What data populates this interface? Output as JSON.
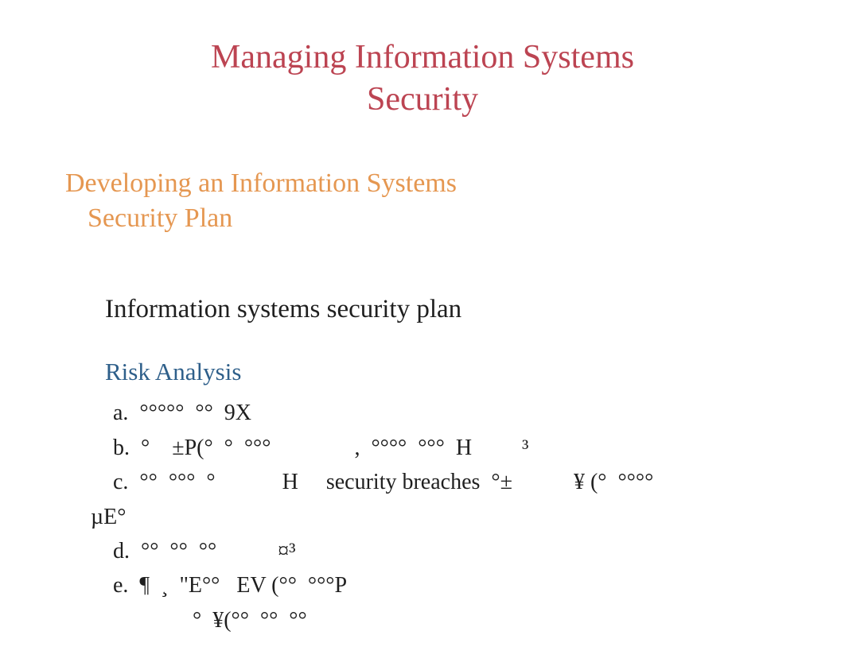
{
  "title_line1": "Managing Information Systems",
  "title_line2": "Security",
  "subtitle_line1": "Developing an Information Systems",
  "subtitle_line2": "Security Plan",
  "body_heading": "Information systems security plan",
  "risk_heading": "Risk Analysis",
  "items": {
    "a": "a.  °°°°°  °°  9X",
    "b": "b.  °    ±P(°  °  °°°               ,  °°°°  °°°  H         ³",
    "c": "c.  °°  °°°  °            H     security breaches  °±           ¥ (°  °°°°",
    "c_wrap": "µE°",
    "d": "d.  °°  °°  °°           ¤³",
    "e": "e.  ¶  ¸  \"E°°   EV (°°  °°°P",
    "e_cont": "°  ¥(°°  °°  °°"
  }
}
